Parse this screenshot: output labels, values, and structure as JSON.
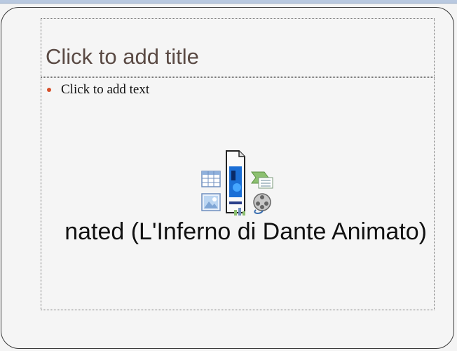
{
  "slide": {
    "title_placeholder": "Click to add title",
    "body_placeholder": "Click to add text",
    "embedded_video_title": "nated (L'Inferno di Dante Animato)"
  },
  "content_icons": [
    {
      "name": "insert-table-icon"
    },
    {
      "name": "insert-media-clip-icon"
    },
    {
      "name": "insert-smartart-icon"
    },
    {
      "name": "insert-picture-icon"
    },
    {
      "name": "insert-chart-icon"
    },
    {
      "name": "insert-video-icon"
    }
  ],
  "colors": {
    "title_text": "#5a4a44",
    "bullet": "#d6502a",
    "placeholder_border": "#777777"
  }
}
